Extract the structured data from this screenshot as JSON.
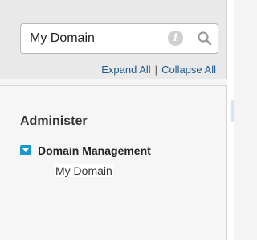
{
  "search": {
    "value": "My Domain",
    "info_icon_glyph": "i"
  },
  "links": {
    "expand_all": "Expand All",
    "separator": "|",
    "collapse_all": "Collapse All"
  },
  "nav": {
    "section_title": "Administer",
    "group": {
      "label": "Domain Management",
      "expanded": true,
      "items": [
        {
          "label": "My Domain"
        }
      ]
    }
  },
  "colors": {
    "link": "#1f5a8e",
    "toggle": "#1a97c9"
  },
  "icons": [
    "info-icon",
    "search-icon",
    "collapse-toggle-icon"
  ]
}
